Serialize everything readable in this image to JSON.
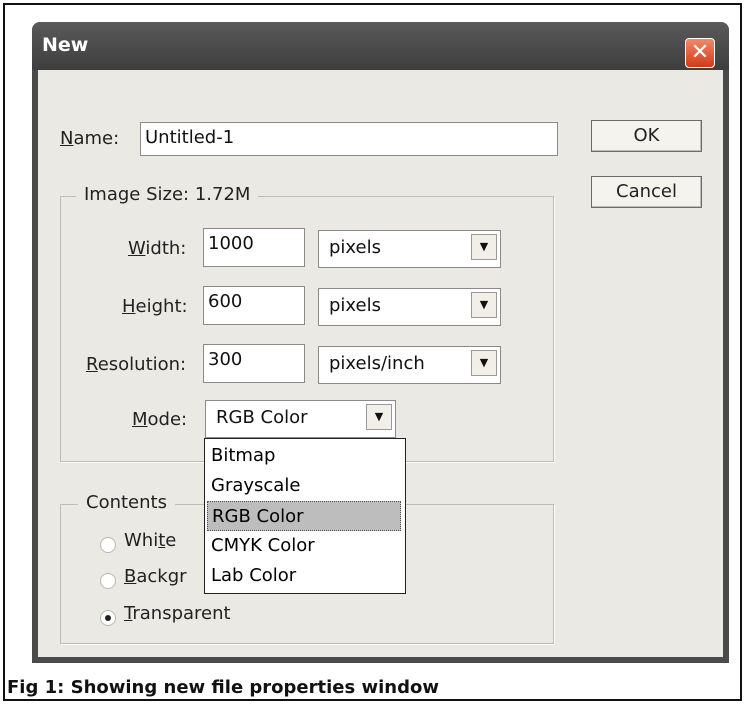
{
  "window": {
    "title": "New",
    "close_glyph": "✕"
  },
  "name": {
    "label": "ame:",
    "underline": "N",
    "value": "Untitled-1"
  },
  "buttons": {
    "ok": "OK",
    "cancel": "Cancel"
  },
  "image_size": {
    "title": "Image Size:",
    "value": "1.72M"
  },
  "width": {
    "label_u": "W",
    "label_rest": "idth:",
    "value": "1000",
    "unit": "pixels"
  },
  "height": {
    "label_u": "H",
    "label_rest": "eight:",
    "value": "600",
    "unit": "pixels"
  },
  "resolution": {
    "label_u": "R",
    "label_rest": "esolution:",
    "value": "300",
    "unit": "pixels/inch"
  },
  "mode": {
    "label_u": "M",
    "label_rest": "ode:",
    "value": "RGB Color",
    "options": [
      "Bitmap",
      "Grayscale",
      "RGB Color",
      "CMYK Color",
      "Lab Color"
    ],
    "selected_index": 2
  },
  "contents": {
    "title": "Contents",
    "white": {
      "pre": "Whi",
      "u": "t",
      "post": "e"
    },
    "background": {
      "pre": "",
      "u": "B",
      "post": "ackgr"
    },
    "transparent": {
      "pre": "",
      "u": "T",
      "post": "ransparent"
    },
    "selected": "transparent"
  },
  "caption": "Fig 1: Showing new file properties window",
  "arrow_glyph": "▼"
}
